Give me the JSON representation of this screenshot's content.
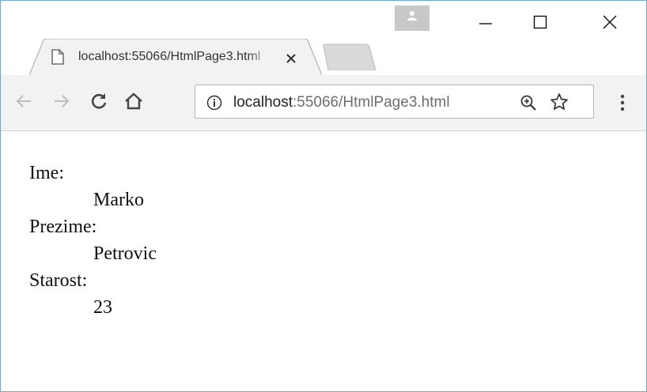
{
  "browser": {
    "tab": {
      "title": "localhost:55066/HtmlPage3.html"
    },
    "address": {
      "host": "localhost",
      "path": ":55066/HtmlPage3.html"
    },
    "icons": [
      "profile-icon",
      "minimize-icon",
      "maximize-icon",
      "close-icon",
      "page-icon",
      "tab-close-icon",
      "back-icon",
      "forward-icon",
      "reload-icon",
      "home-icon",
      "info-icon",
      "zoom-icon",
      "star-icon",
      "menu-icon"
    ]
  },
  "page": {
    "fields": [
      {
        "label": "Ime:",
        "value": "Marko"
      },
      {
        "label": "Prezime:",
        "value": "Petrovic"
      },
      {
        "label": "Starost:",
        "value": "23"
      }
    ]
  }
}
